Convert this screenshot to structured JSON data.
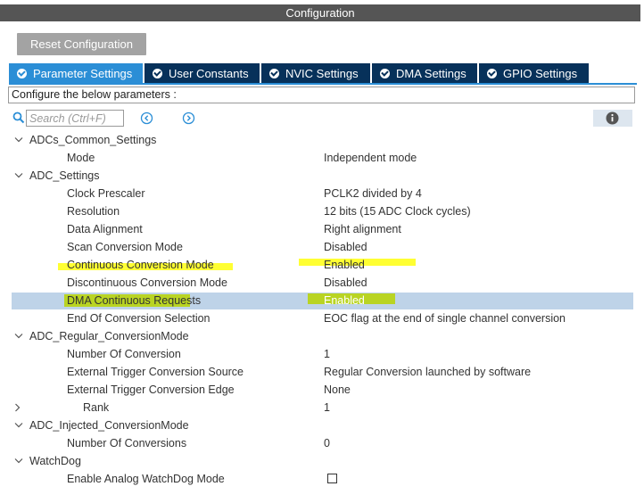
{
  "window": {
    "title": "Configuration"
  },
  "toolbar": {
    "reset_label": "Reset Configuration"
  },
  "tabs": [
    {
      "label": "Parameter Settings",
      "active": true
    },
    {
      "label": "User Constants",
      "active": false
    },
    {
      "label": "NVIC Settings",
      "active": false
    },
    {
      "label": "DMA Settings",
      "active": false
    },
    {
      "label": "GPIO Settings",
      "active": false
    }
  ],
  "config_hint": "Configure the below parameters :",
  "search": {
    "placeholder": "Search (Ctrl+F)",
    "value": ""
  },
  "icons": {
    "search": "search-icon",
    "prev": "circle-chevron-left-icon",
    "next": "circle-chevron-right-icon",
    "info": "info-icon",
    "expanded": "chevron-down-icon",
    "collapsed": "chevron-right-icon"
  },
  "colors": {
    "active_tab": "#2b8ed6",
    "tab": "#07315a",
    "selected_row": "#bed3e8",
    "highlight": "#ffff00"
  },
  "tree": {
    "groups": [
      {
        "label": "ADCs_Common_Settings",
        "params": [
          {
            "label": "Mode",
            "value": "Independent mode"
          }
        ]
      },
      {
        "label": "ADC_Settings",
        "params": [
          {
            "label": "Clock Prescaler",
            "value": "PCLK2 divided by 4"
          },
          {
            "label": "Resolution",
            "value": "12 bits (15 ADC Clock cycles)"
          },
          {
            "label": "Data Alignment",
            "value": "Right alignment"
          },
          {
            "label": "Scan Conversion Mode",
            "value": "Disabled"
          },
          {
            "label": "Continuous Conversion Mode",
            "value": "Enabled",
            "highlighted": true
          },
          {
            "label": "Discontinuous Conversion Mode",
            "value": "Disabled"
          },
          {
            "label": "DMA Continuous Requests",
            "value": "Enabled",
            "highlighted": true,
            "selected": true
          },
          {
            "label": "End Of Conversion Selection",
            "value": "EOC flag at the end of single channel conversion"
          }
        ]
      },
      {
        "label": "ADC_Regular_ConversionMode",
        "params": [
          {
            "label": "Number Of Conversion",
            "value": "1"
          },
          {
            "label": "External Trigger Conversion Source",
            "value": "Regular Conversion launched by software"
          },
          {
            "label": "External Trigger Conversion Edge",
            "value": "None"
          }
        ],
        "subgroup": {
          "label": "Rank",
          "value": "1",
          "expanded": false
        }
      },
      {
        "label": "ADC_Injected_ConversionMode",
        "params": [
          {
            "label": "Number Of Conversions",
            "value": "0"
          }
        ]
      },
      {
        "label": "WatchDog",
        "params": [
          {
            "label": "Enable Analog WatchDog Mode",
            "checked": false
          }
        ]
      }
    ]
  }
}
